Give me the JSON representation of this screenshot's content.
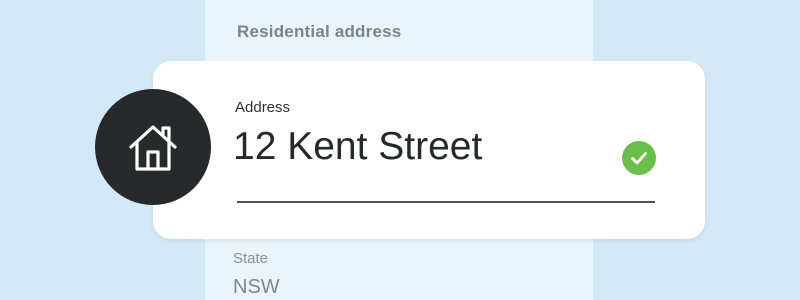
{
  "section": {
    "heading": "Residential address"
  },
  "address_field": {
    "label": "Address",
    "value": "12 Kent Street",
    "status": "valid",
    "icon": "home-icon",
    "status_icon": "check-circle-icon"
  },
  "state_field": {
    "label": "State",
    "value": "NSW"
  },
  "colors": {
    "background": "#d3e9f7",
    "panel": "#eaf4fc",
    "card": "#ffffff",
    "avatar": "#28292b",
    "valid_accent": "#6cbe4c"
  }
}
